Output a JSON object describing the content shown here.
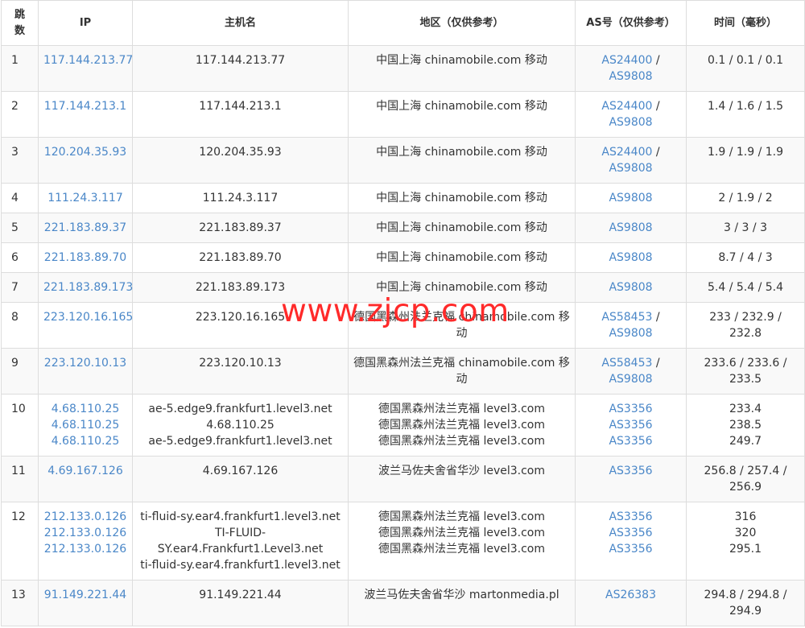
{
  "headers": {
    "hop": "跳数",
    "ip": "IP",
    "host": "主机名",
    "region": "地区（仅供参考）",
    "as": "AS号（仅供参考）",
    "time": "时间（毫秒）"
  },
  "rows": [
    {
      "hop": "1",
      "ips": [
        "117.144.213.77"
      ],
      "hosts": [
        "117.144.213.77"
      ],
      "regions": [
        "中国上海 chinamobile.com 移动"
      ],
      "as": [
        [
          "AS24400",
          "AS9808"
        ]
      ],
      "times": [
        "0.1 / 0.1 / 0.1"
      ]
    },
    {
      "hop": "2",
      "ips": [
        "117.144.213.1"
      ],
      "hosts": [
        "117.144.213.1"
      ],
      "regions": [
        "中国上海 chinamobile.com 移动"
      ],
      "as": [
        [
          "AS24400",
          "AS9808"
        ]
      ],
      "times": [
        "1.4 / 1.6 / 1.5"
      ]
    },
    {
      "hop": "3",
      "ips": [
        "120.204.35.93"
      ],
      "hosts": [
        "120.204.35.93"
      ],
      "regions": [
        "中国上海 chinamobile.com 移动"
      ],
      "as": [
        [
          "AS24400",
          "AS9808"
        ]
      ],
      "times": [
        "1.9 / 1.9 / 1.9"
      ]
    },
    {
      "hop": "4",
      "ips": [
        "111.24.3.117"
      ],
      "hosts": [
        "111.24.3.117"
      ],
      "regions": [
        "中国上海 chinamobile.com 移动"
      ],
      "as": [
        [
          "AS9808"
        ]
      ],
      "times": [
        "2 / 1.9 / 2"
      ]
    },
    {
      "hop": "5",
      "ips": [
        "221.183.89.37"
      ],
      "hosts": [
        "221.183.89.37"
      ],
      "regions": [
        "中国上海 chinamobile.com 移动"
      ],
      "as": [
        [
          "AS9808"
        ]
      ],
      "times": [
        "3 / 3 / 3"
      ]
    },
    {
      "hop": "6",
      "ips": [
        "221.183.89.70"
      ],
      "hosts": [
        "221.183.89.70"
      ],
      "regions": [
        "中国上海 chinamobile.com 移动"
      ],
      "as": [
        [
          "AS9808"
        ]
      ],
      "times": [
        "8.7 / 4 / 3"
      ]
    },
    {
      "hop": "7",
      "ips": [
        "221.183.89.173"
      ],
      "hosts": [
        "221.183.89.173"
      ],
      "regions": [
        "中国上海 chinamobile.com 移动"
      ],
      "as": [
        [
          "AS9808"
        ]
      ],
      "times": [
        "5.4 / 5.4 / 5.4"
      ]
    },
    {
      "hop": "8",
      "ips": [
        "223.120.16.165"
      ],
      "hosts": [
        "223.120.16.165"
      ],
      "regions": [
        "德国黑森州法兰克福 chinamobile.com 移动"
      ],
      "as": [
        [
          "AS58453",
          "AS9808"
        ]
      ],
      "times": [
        "233 / 232.9 / 232.8"
      ]
    },
    {
      "hop": "9",
      "ips": [
        "223.120.10.13"
      ],
      "hosts": [
        "223.120.10.13"
      ],
      "regions": [
        "德国黑森州法兰克福 chinamobile.com 移动"
      ],
      "as": [
        [
          "AS58453",
          "AS9808"
        ]
      ],
      "times": [
        "233.6 / 233.6 / 233.5"
      ]
    },
    {
      "hop": "10",
      "ips": [
        "4.68.110.25",
        "4.68.110.25",
        "4.68.110.25"
      ],
      "hosts": [
        "ae-5.edge9.frankfurt1.level3.net",
        "4.68.110.25",
        "ae-5.edge9.frankfurt1.level3.net"
      ],
      "regions": [
        "德国黑森州法兰克福 level3.com",
        "德国黑森州法兰克福 level3.com",
        "德国黑森州法兰克福 level3.com"
      ],
      "as": [
        [
          "AS3356"
        ],
        [
          "AS3356"
        ],
        [
          "AS3356"
        ]
      ],
      "times": [
        "233.4",
        "238.5",
        "249.7"
      ]
    },
    {
      "hop": "11",
      "ips": [
        "4.69.167.126"
      ],
      "hosts": [
        "4.69.167.126"
      ],
      "regions": [
        "波兰马佐夫舍省华沙 level3.com"
      ],
      "as": [
        [
          "AS3356"
        ]
      ],
      "times": [
        "256.8 / 257.4 / 256.9"
      ]
    },
    {
      "hop": "12",
      "ips": [
        "212.133.0.126",
        "212.133.0.126",
        "212.133.0.126"
      ],
      "hosts": [
        "ti-fluid-sy.ear4.frankfurt1.level3.net",
        "TI-FLUID-SY.ear4.Frankfurt1.Level3.net",
        "ti-fluid-sy.ear4.frankfurt1.level3.net"
      ],
      "regions": [
        "德国黑森州法兰克福 level3.com",
        "德国黑森州法兰克福 level3.com",
        "德国黑森州法兰克福 level3.com"
      ],
      "as": [
        [
          "AS3356"
        ],
        [
          "AS3356"
        ],
        [
          "AS3356"
        ]
      ],
      "times": [
        "316",
        "320",
        "295.1"
      ]
    },
    {
      "hop": "13",
      "ips": [
        "91.149.221.44"
      ],
      "hosts": [
        "91.149.221.44"
      ],
      "regions": [
        "波兰马佐夫舍省华沙 martonmedia.pl"
      ],
      "as": [
        [
          "AS26383"
        ]
      ],
      "times": [
        "294.8 / 294.8 / 294.9"
      ]
    }
  ],
  "watermark": "www.zjcp.com",
  "colors": {
    "link": "#4a87c8",
    "watermark": "#ff2a2a",
    "border": "#dddddd",
    "stripe": "#f9f9f9"
  }
}
